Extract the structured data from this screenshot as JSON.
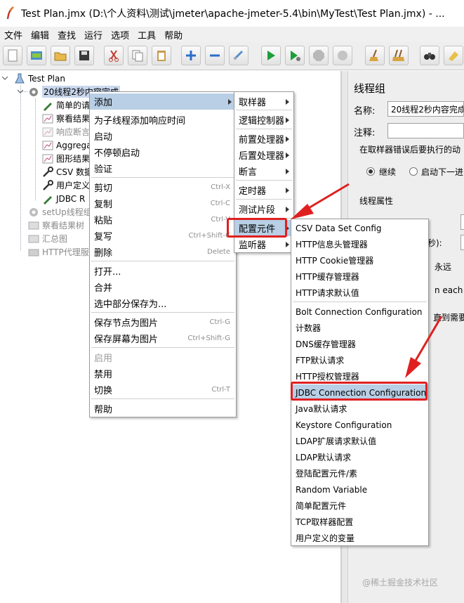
{
  "window": {
    "title": "Test Plan.jmx (D:\\个人资料\\测试\\jmeter\\apache-jmeter-5.4\\bin\\MyTest\\Test Plan.jmx) - ..."
  },
  "menubar": [
    "文件",
    "编辑",
    "查找",
    "运行",
    "选项",
    "工具",
    "帮助"
  ],
  "toolbar": [
    {
      "name": "new-icon"
    },
    {
      "name": "templates-icon"
    },
    {
      "name": "open-icon"
    },
    {
      "name": "save-icon"
    },
    {
      "name": "cut-icon"
    },
    {
      "name": "copy-icon"
    },
    {
      "name": "paste-icon"
    },
    {
      "name": "expand-icon"
    },
    {
      "name": "collapse-icon"
    },
    {
      "name": "toggle-icon"
    },
    {
      "name": "start-icon"
    },
    {
      "name": "start-no-pause-icon"
    },
    {
      "name": "stop-icon"
    },
    {
      "name": "shutdown-icon"
    },
    {
      "name": "clear-icon"
    },
    {
      "name": "clear-all-icon"
    },
    {
      "name": "search-binoculars-icon"
    },
    {
      "name": "reset-search-icon"
    }
  ],
  "tree": {
    "root": "Test Plan",
    "thread_group": "20线程2秒内容完成",
    "children": [
      "简单的请",
      "察看结果",
      "响应断言",
      "Aggrega",
      "图形结果",
      "CSV 数据",
      "用户定义",
      "JDBC R"
    ],
    "others": [
      "setUp线程组",
      "察看结果树",
      "汇总图",
      "HTTP代理服"
    ]
  },
  "right_pane": {
    "heading": "线程组",
    "name_label": "名称:",
    "name_value": "20线程2秒内容完成",
    "comment_label": "注释:",
    "error_label": "在取样器错误后要执行的动",
    "radio_continue": "继续",
    "radio_next": "启动下一进",
    "props_label": "线程属性",
    "seconds_fragment": "秒):",
    "forever_label": "永远",
    "each_iter_fragment": "n each ite",
    "until_needed_fragment": "直到需要"
  },
  "context_menu": {
    "items": [
      {
        "label": "添加"
      },
      {
        "label": "为子线程添加响应时间"
      },
      {
        "label": "启动"
      },
      {
        "label": "不停顿启动"
      },
      {
        "label": "验证"
      },
      {
        "label": "剪切",
        "shortcut": "Ctrl-X"
      },
      {
        "label": "复制",
        "shortcut": "Ctrl-C"
      },
      {
        "label": "粘贴",
        "shortcut": "Ctrl-V"
      },
      {
        "label": "复写",
        "shortcut": "Ctrl+Shift-C"
      },
      {
        "label": "删除",
        "shortcut": "Delete"
      },
      {
        "label": "打开..."
      },
      {
        "label": "合并"
      },
      {
        "label": "选中部分保存为..."
      },
      {
        "label": "保存节点为图片",
        "shortcut": "Ctrl-G"
      },
      {
        "label": "保存屏幕为图片",
        "shortcut": "Ctrl+Shift-G"
      },
      {
        "label": "启用"
      },
      {
        "label": "禁用"
      },
      {
        "label": "切换",
        "shortcut": "Ctrl-T"
      },
      {
        "label": "帮助"
      }
    ]
  },
  "add_submenu": {
    "items": [
      "取样器",
      "逻辑控制器",
      "前置处理器",
      "后置处理器",
      "断言",
      "定时器",
      "测试片段",
      "配置元件",
      "监听器"
    ]
  },
  "config_submenu": {
    "items": [
      "CSV Data Set Config",
      "HTTP信息头管理器",
      "HTTP Cookie管理器",
      "HTTP缓存管理器",
      "HTTP请求默认值",
      "Bolt Connection Configuration",
      "计数器",
      "DNS缓存管理器",
      "FTP默认请求",
      "HTTP授权管理器",
      "JDBC Connection Configuration",
      "Java默认请求",
      "Keystore Configuration",
      "LDAP扩展请求默认值",
      "LDAP默认请求",
      "登陆配置元件/素",
      "Random Variable",
      "简单配置元件",
      "TCP取样器配置",
      "用户定义的变量"
    ]
  },
  "watermark": "@稀土掘金技术社区",
  "colors": {
    "highlight": "#b8cfe5",
    "annotation_red": "#e02020",
    "tree_selection": "#c9d8ee"
  }
}
